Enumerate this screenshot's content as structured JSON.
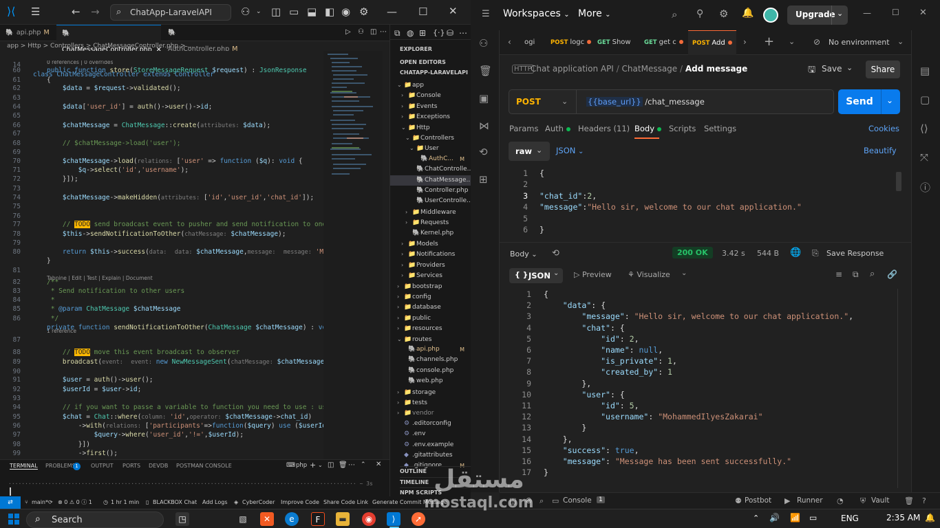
{
  "vscode": {
    "search_text": "ChatApp-LaravelAPI",
    "tabs": [
      {
        "label": "api.php",
        "mod": "M"
      },
      {
        "label": "ChatMessageController.php",
        "mod": ""
      },
      {
        "label": "AuthController.php",
        "mod": "M"
      }
    ],
    "breadcrumb": "app > Http > Controllers > ChatMessageController.php > …",
    "sticky_line": {
      "num": "14",
      "code": "class ChatMessageController extends Controller"
    },
    "references_1": "0 references | 0 overrides",
    "tabnine": "Tabnine | Edit | Test | Explain | Document",
    "references_2": "1 reference",
    "lines": [
      {
        "n": "60",
        "html": "<span class=\"k\">public function</span> <span class=\"f\">store</span>(<span class=\"t\">StoreMessageRequest</span> <span class=\"v\">$request</span>) : <span class=\"t\">JsonResponse</span>"
      },
      {
        "n": "61",
        "html": "{"
      },
      {
        "n": "62",
        "html": "    <span class=\"v\">$data</span> = <span class=\"v\">$request</span>-><span class=\"f\">validated</span>();"
      },
      {
        "n": "63",
        "html": ""
      },
      {
        "n": "64",
        "html": "    <span class=\"v\">$data</span>[<span class=\"s\">'user_id'</span>] = <span class=\"f\">auth</span>()-><span class=\"f\">user</span>()-><span class=\"v\">id</span>;"
      },
      {
        "n": "65",
        "html": ""
      },
      {
        "n": "66",
        "html": "    <span class=\"v\">$chatMessage</span> = <span class=\"t\">ChatMessage</span>::<span class=\"f\">create</span>(<span class=\"h\">attributes:</span> <span class=\"v\">$data</span>);"
      },
      {
        "n": "67",
        "html": ""
      },
      {
        "n": "68",
        "html": "    <span class=\"c\">// $chatMessage->load('user');</span>"
      },
      {
        "n": "69",
        "html": ""
      },
      {
        "n": "70",
        "html": "    <span class=\"v\">$chatMessage</span>-><span class=\"f\">load</span>(<span class=\"h\">relations:</span> [<span class=\"s\">'user'</span> => <span class=\"k\">function</span> (<span class=\"v\">$q</span>): <span class=\"k\">void</span> {"
      },
      {
        "n": "71",
        "html": "        <span class=\"v\">$q</span>-><span class=\"f\">select</span>(<span class=\"s\">'id'</span>,<span class=\"s\">'username'</span>);"
      },
      {
        "n": "72",
        "html": "    }]);"
      },
      {
        "n": "73",
        "html": ""
      },
      {
        "n": "74",
        "html": "    <span class=\"v\">$chatMessage</span>-><span class=\"f\">makeHidden</span>(<span class=\"h\">attributes:</span> [<span class=\"s\">'id'</span>,<span class=\"s\">'user_id'</span>,<span class=\"s\">'chat_id'</span>]);"
      },
      {
        "n": "75",
        "html": ""
      },
      {
        "n": "76",
        "html": ""
      },
      {
        "n": "77",
        "html": "    <span class=\"c\">// <span class=\"todo\">TODO</span> send broadcast event to pusher and send notification to onesig</span>"
      },
      {
        "n": "78",
        "html": "    <span class=\"v\">$this</span>-><span class=\"f\">sendNotificationToOther</span>(<span class=\"h\">chatMessage:</span> <span class=\"v\">$chatMessage</span>);"
      },
      {
        "n": "79",
        "html": ""
      },
      {
        "n": "80",
        "html": "    <span class=\"k\">return</span> <span class=\"v\">$this</span>-><span class=\"f\">success</span>(<span class=\"h\">data:</span>  <span class=\"h\">data:</span> <span class=\"v\">$chatMessage</span>,<span class=\"h\">message:</span>  <span class=\"h\">message:</span> <span class=\"s\">'Messa</span>"
      },
      {
        "n": "",
        "html": "}"
      },
      {
        "n": "81",
        "html": ""
      },
      {
        "n": "82",
        "html": "<span class=\"c\">/**</span>"
      },
      {
        "n": "83",
        "html": "<span class=\"c\"> * Send notification to other users</span>"
      },
      {
        "n": "84",
        "html": "<span class=\"c\"> *</span>"
      },
      {
        "n": "85",
        "html": "<span class=\"c\"> * <span class=\"k\">@param</span> <span class=\"t\">ChatMessage</span> <span class=\"v\">$chatMessage</span></span>"
      },
      {
        "n": "86",
        "html": "<span class=\"c\"> */</span>"
      },
      {
        "n": "",
        "html": "<span class=\"k\">private function</span> <span class=\"f\">sendNotificationToOther</span>(<span class=\"t\">ChatMessage</span> <span class=\"v\">$chatMessage</span>) : <span class=\"k\">void</span> {"
      },
      {
        "n": "87",
        "html": ""
      },
      {
        "n": "88",
        "html": "    <span class=\"c\">// <span class=\"todo\">TODO</span> move this event broadcast to observer</span>"
      },
      {
        "n": "89",
        "html": "    <span class=\"f\">broadcast</span>(<span class=\"h\">event:</span>  <span class=\"h\">event:</span> <span class=\"k\">new</span> <span class=\"t\">NewMessageSent</span>(<span class=\"h\">chatMessage:</span> <span class=\"v\">$chatMessage</span>))-"
      },
      {
        "n": "90",
        "html": ""
      },
      {
        "n": "91",
        "html": "    <span class=\"v\">$user</span> = <span class=\"f\">auth</span>()-><span class=\"f\">user</span>();"
      },
      {
        "n": "92",
        "html": "    <span class=\"v\">$userId</span> = <span class=\"v\">$user</span>-><span class=\"v\">id</span>;"
      },
      {
        "n": "93",
        "html": ""
      },
      {
        "n": "94",
        "html": "    <span class=\"c\">// if you want to passe a variable to function you need to use : use($v</span>"
      },
      {
        "n": "95",
        "html": "    <span class=\"v\">$chat</span> = <span class=\"t\">Chat</span>::<span class=\"f\">where</span>(<span class=\"h\">column:</span> <span class=\"s\">'id'</span>,<span class=\"h\">operator:</span> <span class=\"v\">$chatMessage</span>-><span class=\"v\">chat_id</span>)"
      },
      {
        "n": "96",
        "html": "        -><span class=\"f\">with</span>(<span class=\"h\">relations:</span> [<span class=\"s\">'participants'</span>=><span class=\"k\">function</span>(<span class=\"v\">$query</span>) <span class=\"k\">use</span> (<span class=\"v\">$userId</span>):"
      },
      {
        "n": "97",
        "html": "            <span class=\"v\">$query</span>-><span class=\"f\">where</span>(<span class=\"s\">'user_id'</span>,<span class=\"s\">'!='</span>,<span class=\"v\">$userId</span>);"
      },
      {
        "n": "98",
        "html": "        }])"
      },
      {
        "n": "99",
        "html": "        -><span class=\"f\">first</span>();"
      },
      {
        "n": "100",
        "html": ""
      }
    ],
    "explorer": {
      "title": "EXPLORER",
      "open_editors": "OPEN EDITORS",
      "project": "CHATAPP-LARAVELAPI",
      "tree": [
        {
          "label": "app",
          "indent": 1,
          "ch": "⌄",
          "ic": "📁",
          "color": "#ccc",
          "type": "folder"
        },
        {
          "label": "Console",
          "indent": 2,
          "ch": "›",
          "ic": "📁",
          "color": "#ccc",
          "type": "folder"
        },
        {
          "label": "Events",
          "indent": 2,
          "ch": "›",
          "ic": "📁",
          "color": "#ccc",
          "type": "folder"
        },
        {
          "label": "Exceptions",
          "indent": 2,
          "ch": "›",
          "ic": "📁",
          "color": "#ccc",
          "type": "folder"
        },
        {
          "label": "Http",
          "indent": 2,
          "ch": "⌄",
          "ic": "📁",
          "color": "#ccc",
          "type": "folder"
        },
        {
          "label": "Controllers",
          "indent": 3,
          "ch": "⌄",
          "ic": "📁",
          "color": "#ccc",
          "type": "folder"
        },
        {
          "label": "User",
          "indent": 4,
          "ch": "⌄",
          "ic": "📁",
          "color": "#ccc",
          "type": "folder"
        },
        {
          "label": "AuthC...",
          "indent": 5,
          "ch": "",
          "ic": "🐘",
          "color": "#e2c08d",
          "type": "file",
          "mark": "M"
        },
        {
          "label": "ChatControlle...",
          "indent": 4,
          "ch": "",
          "ic": "🐘",
          "color": "#ccc",
          "type": "file"
        },
        {
          "label": "ChatMessage...",
          "indent": 4,
          "ch": "",
          "ic": "🐘",
          "color": "#ccc",
          "type": "file",
          "sel": true
        },
        {
          "label": "Controller.php",
          "indent": 4,
          "ch": "",
          "ic": "🐘",
          "color": "#ccc",
          "type": "file"
        },
        {
          "label": "UserControlle...",
          "indent": 4,
          "ch": "",
          "ic": "🐘",
          "color": "#ccc",
          "type": "file"
        },
        {
          "label": "Middleware",
          "indent": 3,
          "ch": "›",
          "ic": "📁",
          "color": "#ccc",
          "type": "folder"
        },
        {
          "label": "Requests",
          "indent": 3,
          "ch": "›",
          "ic": "📁",
          "color": "#ccc",
          "type": "folder"
        },
        {
          "label": "Kernel.php",
          "indent": 3,
          "ch": "",
          "ic": "🐘",
          "color": "#ccc",
          "type": "file"
        },
        {
          "label": "Models",
          "indent": 2,
          "ch": "›",
          "ic": "📁",
          "color": "#ccc",
          "type": "folder"
        },
        {
          "label": "Notifications",
          "indent": 2,
          "ch": "›",
          "ic": "📁",
          "color": "#ccc",
          "type": "folder"
        },
        {
          "label": "Providers",
          "indent": 2,
          "ch": "›",
          "ic": "📁",
          "color": "#ccc",
          "type": "folder"
        },
        {
          "label": "Services",
          "indent": 2,
          "ch": "›",
          "ic": "📁",
          "color": "#ccc",
          "type": "folder"
        },
        {
          "label": "bootstrap",
          "indent": 1,
          "ch": "›",
          "ic": "📁",
          "color": "#ccc",
          "type": "folder"
        },
        {
          "label": "config",
          "indent": 1,
          "ch": "›",
          "ic": "📁",
          "color": "#ccc",
          "type": "folder"
        },
        {
          "label": "database",
          "indent": 1,
          "ch": "›",
          "ic": "📁",
          "color": "#ccc",
          "type": "folder"
        },
        {
          "label": "public",
          "indent": 1,
          "ch": "›",
          "ic": "📁",
          "color": "#ccc",
          "type": "folder"
        },
        {
          "label": "resources",
          "indent": 1,
          "ch": "›",
          "ic": "📁",
          "color": "#ccc",
          "type": "folder"
        },
        {
          "label": "routes",
          "indent": 1,
          "ch": "⌄",
          "ic": "📁",
          "color": "#ccc",
          "type": "folder"
        },
        {
          "label": "api.php",
          "indent": 2,
          "ch": "",
          "ic": "🐘",
          "color": "#e2c08d",
          "type": "file",
          "mark": "M"
        },
        {
          "label": "channels.php",
          "indent": 2,
          "ch": "",
          "ic": "🐘",
          "color": "#ccc",
          "type": "file"
        },
        {
          "label": "console.php",
          "indent": 2,
          "ch": "",
          "ic": "🐘",
          "color": "#ccc",
          "type": "file"
        },
        {
          "label": "web.php",
          "indent": 2,
          "ch": "",
          "ic": "🐘",
          "color": "#ccc",
          "type": "file"
        },
        {
          "label": "storage",
          "indent": 1,
          "ch": "›",
          "ic": "📁",
          "color": "#ccc",
          "type": "folder"
        },
        {
          "label": "tests",
          "indent": 1,
          "ch": "›",
          "ic": "📁",
          "color": "#ccc",
          "type": "folder"
        },
        {
          "label": "vendor",
          "indent": 1,
          "ch": "›",
          "ic": "📁",
          "color": "#8c8c8c",
          "type": "folder"
        },
        {
          "label": ".editorconfig",
          "indent": 1,
          "ch": "",
          "ic": "⚙",
          "color": "#ccc",
          "type": "file"
        },
        {
          "label": ".env",
          "indent": 1,
          "ch": "",
          "ic": "⚙",
          "color": "#ccc",
          "type": "file"
        },
        {
          "label": ".env.example",
          "indent": 1,
          "ch": "",
          "ic": "⚙",
          "color": "#ccc",
          "type": "file"
        },
        {
          "label": ".gitattributes",
          "indent": 1,
          "ch": "",
          "ic": "◆",
          "color": "#ccc",
          "type": "file"
        },
        {
          "label": ".gitignore",
          "indent": 1,
          "ch": "",
          "ic": "◆",
          "color": "#ccc",
          "type": "file",
          "mark": "M"
        }
      ],
      "sections": [
        "OUTLINE",
        "TIMELINE",
        "NPM SCRIPTS"
      ]
    },
    "panel": {
      "tabs": [
        "TERMINAL",
        "PROBLEMS",
        "OUTPUT",
        "PORTS",
        "DEVDB",
        "POSTMAN CONSOLE"
      ],
      "problems_count": "1",
      "shell": "php",
      "terminal_line": "~ 3s"
    },
    "status": {
      "branch": "main*",
      "problems": "⊗ 0 ⚠ 0 ⓘ 1",
      "time": "1 hr 1 min",
      "items": [
        "BLACKBOX Chat",
        "Add Logs",
        "CyberCoder",
        "Improve Code",
        "Share Code Link",
        "Generate Commit Message"
      ]
    }
  },
  "postman": {
    "workspaces": "Workspaces",
    "more": "More",
    "upgrade": "Upgrade",
    "tabs": [
      {
        "method": "",
        "name": "ogi"
      },
      {
        "method": "POST",
        "name": "logc"
      },
      {
        "method": "GET",
        "name": "Show"
      },
      {
        "method": "GET",
        "name": "get c"
      },
      {
        "method": "POST",
        "name": "Add"
      }
    ],
    "environment": "No environment",
    "breadcrumb": {
      "collection": "Chat application API",
      "folder": "ChatMessage",
      "request": "Add message"
    },
    "save": "Save",
    "share": "Share",
    "method": "POST",
    "url_var": "{{base_url}}",
    "url_path": " /chat_message",
    "send": "Send",
    "req_tabs": [
      "Params",
      "Auth",
      "Headers (11)",
      "Body",
      "Scripts",
      "Settings"
    ],
    "cookies": "Cookies",
    "body_mode": "raw",
    "body_format": "JSON",
    "beautify": "Beautify",
    "request_body": [
      {
        "n": "1",
        "html": "{"
      },
      {
        "n": "2",
        "html": ""
      },
      {
        "n": "3",
        "html": "<span class=\"jk\">\"chat_id\"</span>:<span class=\"jn\">2</span>,"
      },
      {
        "n": "4",
        "html": "<span class=\"jk\">\"message\"</span>:<span class=\"js\">\"Hello sir, welcome to our chat application.\"</span>"
      },
      {
        "n": "5",
        "html": ""
      },
      {
        "n": "6",
        "html": "}"
      }
    ],
    "response": {
      "label": "Body",
      "status": "200 OK",
      "time": "3.42 s",
      "size": "544 B",
      "save_response": "Save Response",
      "format": "JSON",
      "preview": "Preview",
      "visualize": "Visualize",
      "lines": [
        {
          "n": "1",
          "html": "{"
        },
        {
          "n": "2",
          "html": "    <span class=\"jk\">\"data\"</span>: {"
        },
        {
          "n": "3",
          "html": "        <span class=\"jk\">\"message\"</span>: <span class=\"js\">\"Hello sir, welcome to our chat application.\"</span>,"
        },
        {
          "n": "4",
          "html": "        <span class=\"jk\">\"chat\"</span>: {"
        },
        {
          "n": "5",
          "html": "            <span class=\"jk\">\"id\"</span>: <span class=\"jn\">2</span>,"
        },
        {
          "n": "6",
          "html": "            <span class=\"jk\">\"name\"</span>: <span class=\"jb\">null</span>,"
        },
        {
          "n": "7",
          "html": "            <span class=\"jk\">\"is_private\"</span>: <span class=\"jn\">1</span>,"
        },
        {
          "n": "8",
          "html": "            <span class=\"jk\">\"created_by\"</span>: <span class=\"jn\">1</span>"
        },
        {
          "n": "9",
          "html": "        },"
        },
        {
          "n": "10",
          "html": "        <span class=\"jk\">\"user\"</span>: {"
        },
        {
          "n": "11",
          "html": "            <span class=\"jk\">\"id\"</span>: <span class=\"jn\">5</span>,"
        },
        {
          "n": "12",
          "html": "            <span class=\"jk\">\"username\"</span>: <span class=\"js\">\"MohammedIlyesZakarai\"</span>"
        },
        {
          "n": "13",
          "html": "        }"
        },
        {
          "n": "14",
          "html": "    },"
        },
        {
          "n": "15",
          "html": "    <span class=\"jk\">\"success\"</span>: <span class=\"jb\">true</span>,"
        },
        {
          "n": "16",
          "html": "    <span class=\"jk\">\"message\"</span>: <span class=\"js\">\"Message has been sent successfully.\"</span>"
        },
        {
          "n": "17",
          "html": "}"
        }
      ]
    },
    "bottom": {
      "console": "Console",
      "postbot": "Postbot",
      "runner": "Runner",
      "vault": "Vault"
    }
  },
  "taskbar": {
    "search": "Search",
    "lang": "ENG",
    "time": "2:35 AM"
  },
  "watermark": {
    "arabic": "مستقل",
    "latin": "mostaql.com"
  }
}
